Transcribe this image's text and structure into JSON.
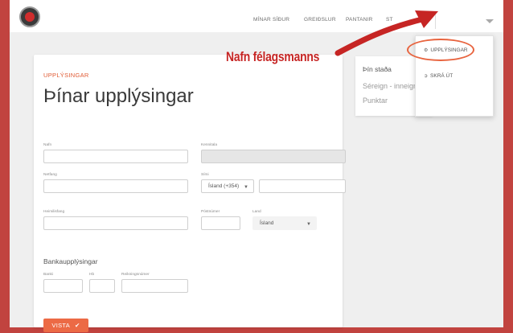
{
  "nav": {
    "links": [
      "MÍNAR SÍÐUR",
      "GREIÐSLUR",
      "PANTANIR",
      "ST"
    ],
    "logo_icon": "club-logo"
  },
  "dropdown": {
    "items": [
      {
        "icon": "cogs-icon",
        "label": "UPPLÝSINGAR"
      },
      {
        "icon": "sign-out-icon",
        "label": "SKRÁ ÚT"
      }
    ]
  },
  "annotation": {
    "text": "Nafn félagsmanns",
    "color": "#c62524"
  },
  "card": {
    "section_label": "UPPLÝSINGAR",
    "title": "Þínar upplýsingar",
    "fields": {
      "nafn": "Nafn",
      "kennitala": "Kennitala",
      "netfang": "Netfang",
      "simi": "Sími",
      "phone_country": "Ísland (+354)",
      "heimilisfang": "Heimilisfang",
      "postnumer": "Póstnúmer",
      "land": "Land",
      "land_value": "Ísland"
    },
    "bank": {
      "heading": "Bankaupplýsingar",
      "banki": "Banki",
      "hb": "Hb",
      "reikningsnumer": "Reikningsnúmer"
    },
    "save_label": "VISTA"
  },
  "status": {
    "title": "Þín staða",
    "line1": "Séreign - inneign",
    "line2": "Punktar"
  },
  "colors": {
    "brand_red": "#c1433f",
    "accent_orange": "#ec6a45"
  }
}
